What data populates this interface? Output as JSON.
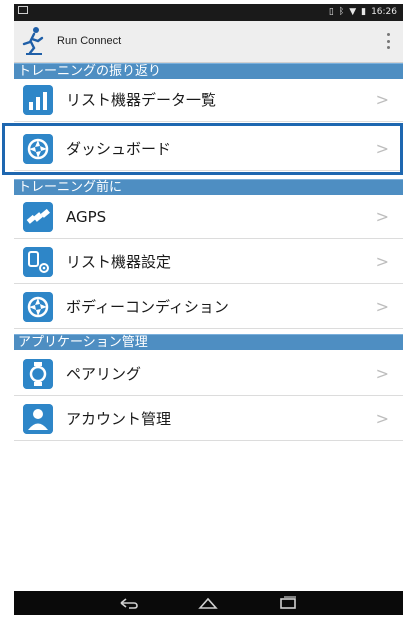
{
  "status_bar": {
    "time": "16:26"
  },
  "app": {
    "title": "Run Connect"
  },
  "sections": {
    "review": "トレーニングの振り返り",
    "before": "トレーニング前に",
    "app_mgmt": "アプリケーション管理"
  },
  "items": {
    "watch_data_list": "リスト機器データ一覧",
    "dashboard": "ダッシュボード",
    "agps": "AGPS",
    "watch_settings": "リスト機器設定",
    "body_condition": "ボディーコンディション",
    "pairing": "ペアリング",
    "account": "アカウント管理"
  },
  "colors": {
    "section_header": "#4e8ec2",
    "icon_blue": "#2e86c8",
    "highlight_border": "#1e67b0"
  }
}
